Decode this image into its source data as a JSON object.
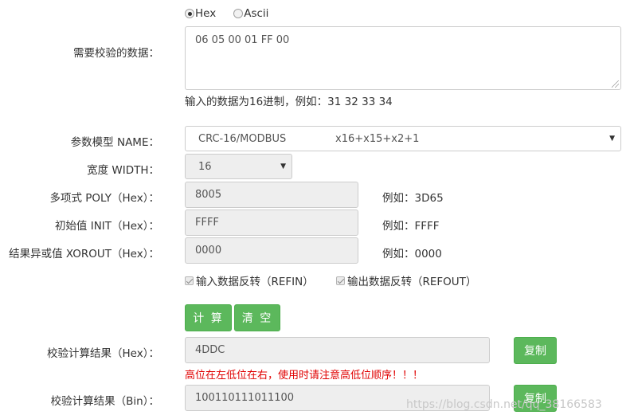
{
  "format": {
    "options": [
      {
        "label": "Hex",
        "selected": true
      },
      {
        "label": "Ascii",
        "selected": false
      }
    ]
  },
  "data_input": {
    "label": "需要校验的数据：",
    "value": "06 05 00 01 FF 00",
    "hint": "输入的数据为16进制，例如：31 32 33 34"
  },
  "model": {
    "label": "参数模型 NAME：",
    "selected_name": "CRC-16/MODBUS",
    "selected_poly": "x16+x15+x2+1"
  },
  "width": {
    "label": "宽度 WIDTH：",
    "value": "16"
  },
  "poly": {
    "label": "多项式 POLY（Hex）：",
    "value": "8005",
    "example": "例如：3D65"
  },
  "init": {
    "label": "初始值 INIT（Hex）：",
    "value": "FFFF",
    "example": "例如：FFFF"
  },
  "xorout": {
    "label": "结果异或值 XOROUT（Hex）：",
    "value": "0000",
    "example": "例如：0000"
  },
  "refin": {
    "label": "输入数据反转（REFIN）",
    "checked": true
  },
  "refout": {
    "label": "输出数据反转（REFOUT）",
    "checked": true
  },
  "buttons": {
    "calc": "计 算",
    "clear": "清 空",
    "copy": "复制"
  },
  "result_hex": {
    "label": "校验计算结果（Hex）：",
    "value": "4DDC",
    "warning": "高位在左低位在右，使用时请注意高低位顺序！！！"
  },
  "result_bin": {
    "label": "校验计算结果（Bin）：",
    "value": "100110111011100"
  },
  "watermark": "https://blog.csdn.net/qq_38166583",
  "colors": {
    "button_green": "#5cb85c",
    "warning_red": "#e00000",
    "readonly_bg": "#eeeeee"
  }
}
